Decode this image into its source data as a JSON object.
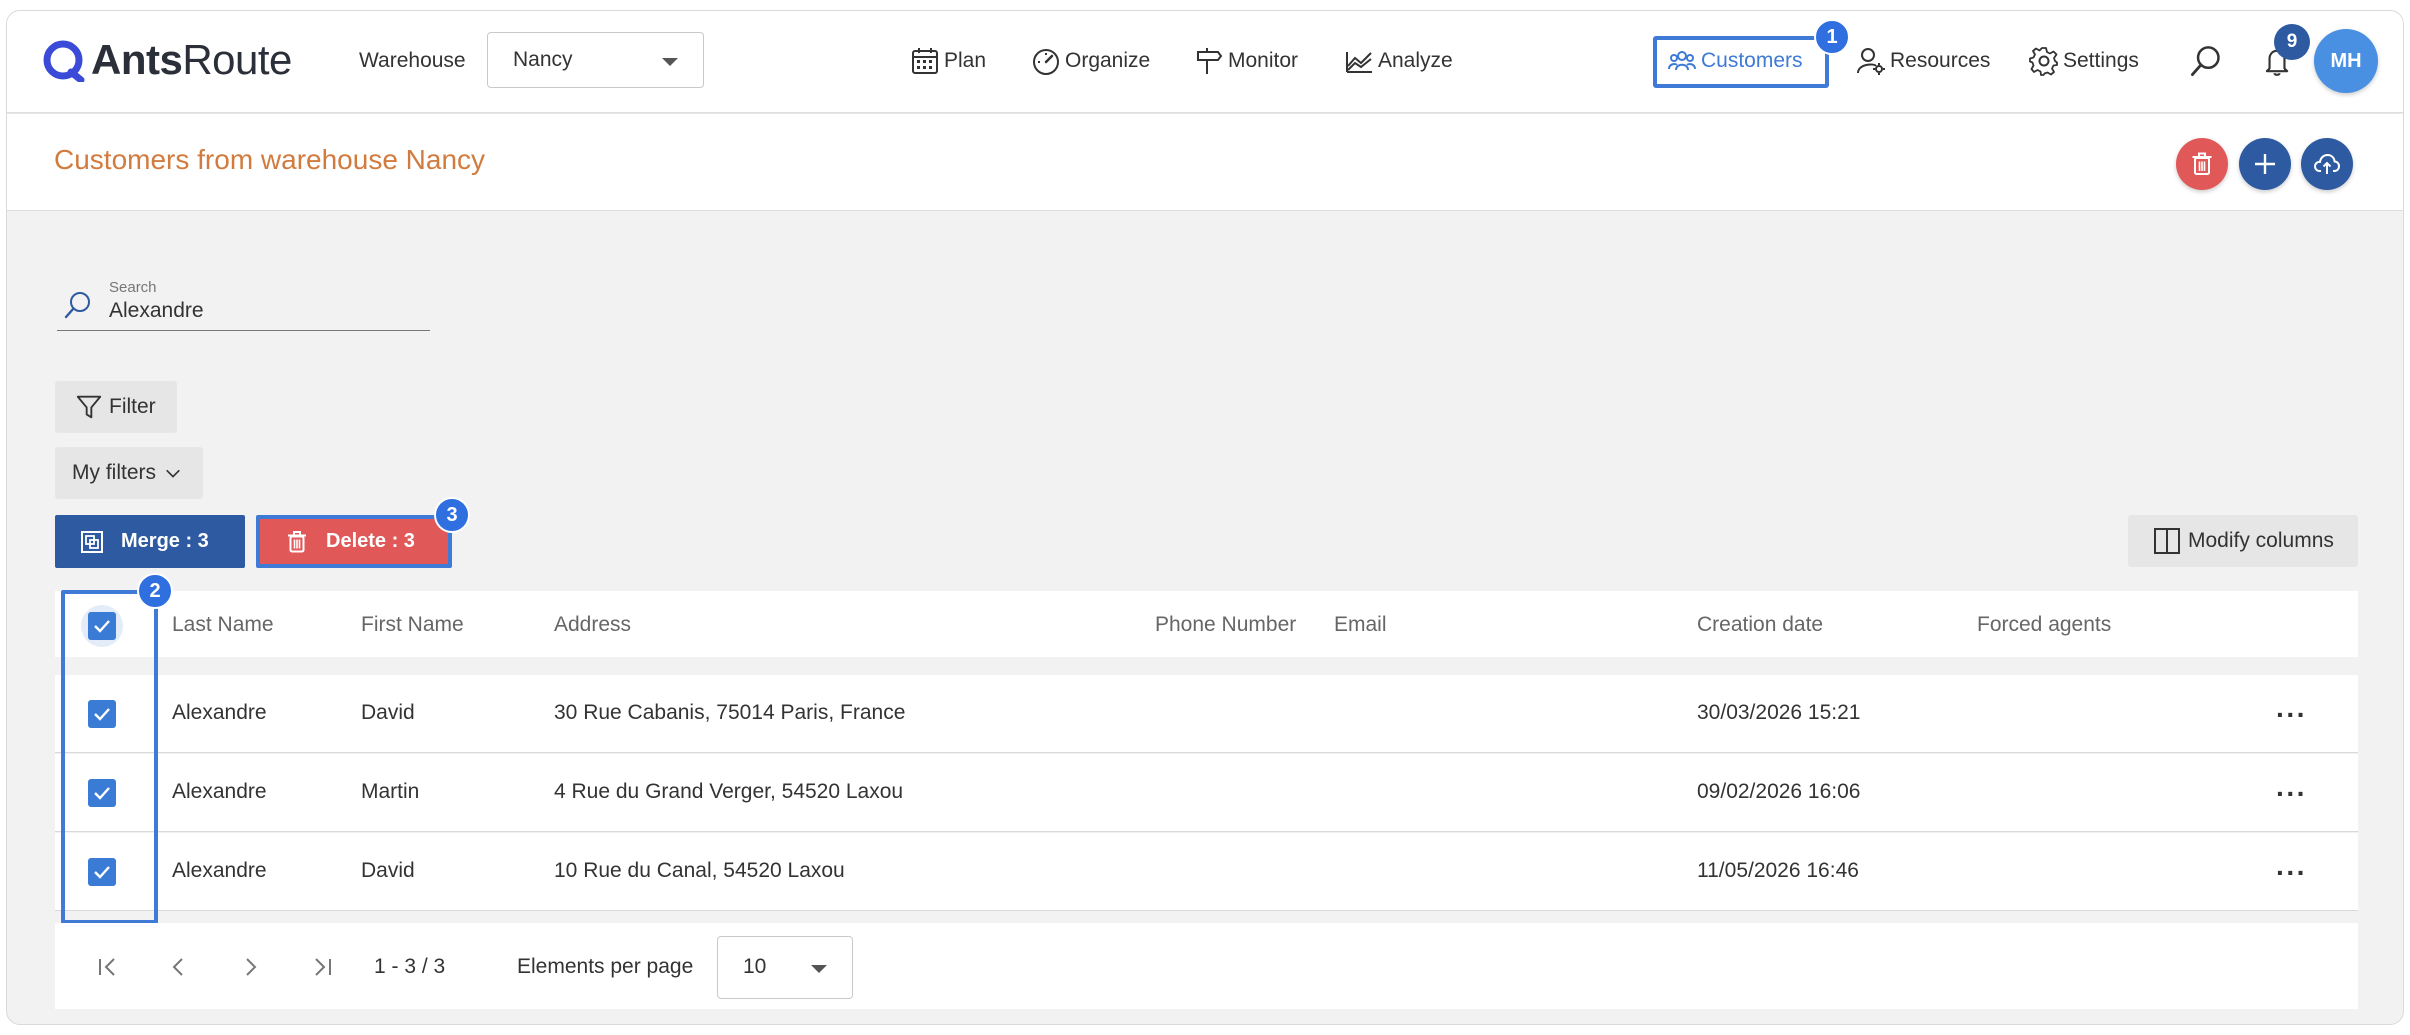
{
  "brand": {
    "name_bold": "Ants",
    "name_light": "Route"
  },
  "warehouse": {
    "label": "Warehouse",
    "value": "Nancy"
  },
  "nav": {
    "plan": "Plan",
    "organize": "Organize",
    "monitor": "Monitor",
    "analyze": "Analyze",
    "customers": "Customers",
    "resources": "Resources",
    "settings": "Settings"
  },
  "notifications": {
    "count": "9"
  },
  "user": {
    "initials": "MH"
  },
  "annotations": {
    "customers": "1",
    "select_column": "2",
    "delete": "3"
  },
  "page": {
    "title": "Customers from warehouse Nancy"
  },
  "search": {
    "label": "Search",
    "value": "Alexandre"
  },
  "filters": {
    "filter_label": "Filter",
    "my_filters_label": "My filters"
  },
  "actions": {
    "merge": "Merge : 3",
    "delete": "Delete : 3",
    "modify_columns": "Modify columns"
  },
  "table": {
    "columns": [
      "Last Name",
      "First Name",
      "Address",
      "Phone Number",
      "Email",
      "Creation date",
      "Forced agents"
    ],
    "rows": [
      {
        "last_name": "Alexandre",
        "first_name": "David",
        "address": "30 Rue Cabanis, 75014 Paris, France",
        "phone": "",
        "email": "",
        "created": "30/03/2026 15:21",
        "forced_agents": "",
        "selected": true
      },
      {
        "last_name": "Alexandre",
        "first_name": "Martin",
        "address": "4 Rue du Grand Verger, 54520 Laxou",
        "phone": "",
        "email": "",
        "created": "09/02/2026 16:06",
        "forced_agents": "",
        "selected": true
      },
      {
        "last_name": "Alexandre",
        "first_name": "David",
        "address": "10 Rue du Canal, 54520 Laxou",
        "phone": "",
        "email": "",
        "created": "11/05/2026 16:46",
        "forced_agents": "",
        "selected": true
      }
    ],
    "row_menu": "···"
  },
  "pagination": {
    "range": "1 - 3 / 3",
    "per_page_label": "Elements per page",
    "per_page_value": "10"
  },
  "colors": {
    "accent": "#2d5aa0",
    "danger": "#e05858",
    "title": "#d27b3e",
    "highlight": "#3f7ad6"
  }
}
